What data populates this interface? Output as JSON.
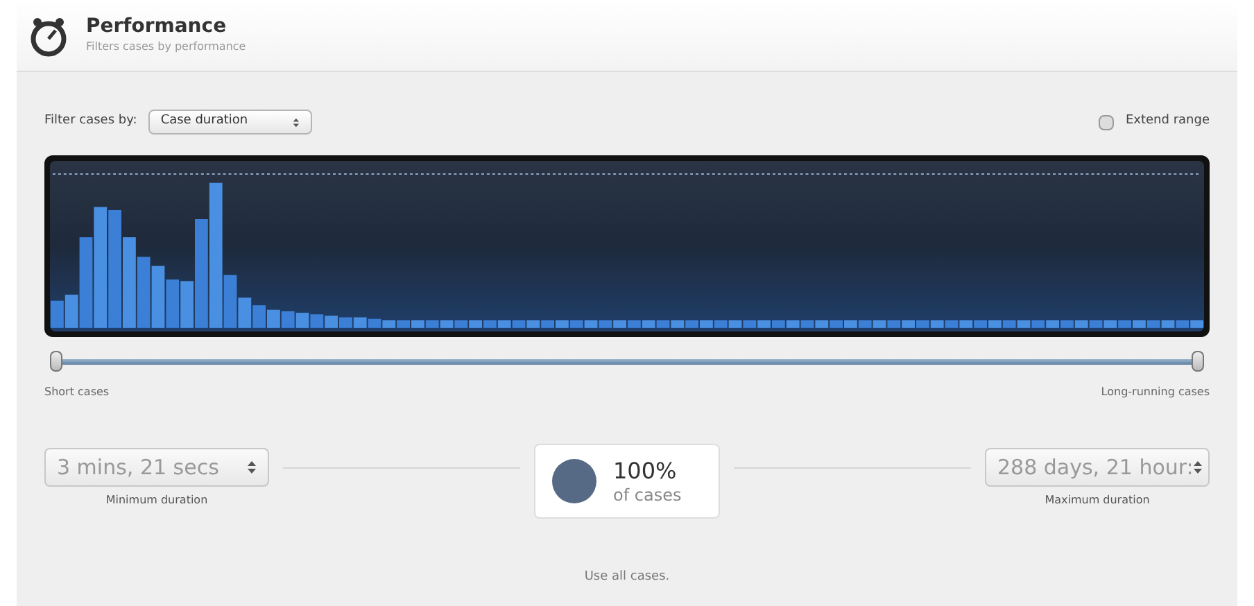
{
  "header": {
    "title": "Performance",
    "subtitle": "Filters cases by performance"
  },
  "filter": {
    "label": "Filter cases by:",
    "value": "Case duration"
  },
  "extend_range": {
    "label": "Extend range",
    "checked": false
  },
  "range_slider": {
    "thumbs": [
      {
        "level": 0
      },
      {
        "level": 1
      }
    ]
  },
  "ends": {
    "short_label": "Short cases",
    "long_label": "Long-running cases"
  },
  "minimum": {
    "value": "3 mins, 21 secs",
    "caption": "Minimum duration"
  },
  "summary": {
    "percent": "100%",
    "caption": "of cases"
  },
  "maximum": {
    "value": "288 days, 21 hour:",
    "caption": "Maximum duration"
  },
  "footer": "Use all cases."
}
